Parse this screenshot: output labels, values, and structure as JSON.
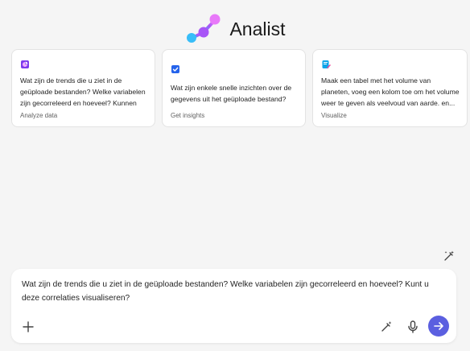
{
  "app": {
    "title": "Analist"
  },
  "cards": [
    {
      "icon": "chart-icon",
      "text": "Wat zijn de trends die u ziet in de geüploade bestanden? Welke variabelen zijn gecorreleerd en hoeveel? Kunnen",
      "tag": "Analyze data"
    },
    {
      "icon": "checkbox-icon",
      "text": "Wat zijn enkele snelle inzichten over de gegevens uit het geüploade bestand?",
      "tag": "Get insights"
    },
    {
      "icon": "document-edit-icon",
      "text": "Maak een tabel met het volume van planeten, voeg een kolom toe om het volume weer te geven als veelvoud van aarde. en...",
      "tag": "Visualize"
    }
  ],
  "composer": {
    "text": "Wat zijn de trends die u ziet in de geüploade bestanden? Welke variabelen zijn gecorreleerd en hoeveel? Kunt u deze correlaties visualiseren?"
  },
  "colors": {
    "accent": "#5b5fe0",
    "logo_magenta": "#d946ef",
    "logo_purple": "#a855f7",
    "logo_blue": "#38bdf8"
  }
}
